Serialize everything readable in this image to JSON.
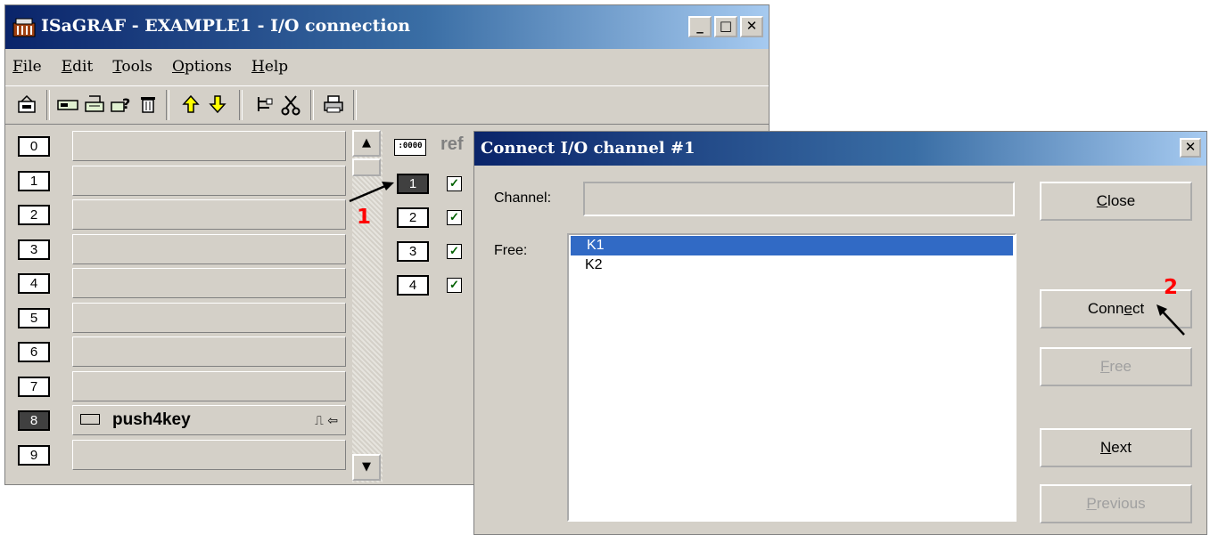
{
  "main_window": {
    "title": "ISaGRAF - EXAMPLE1 - I/O connection",
    "controls": {
      "minimize": "_",
      "maximize": "□",
      "close": "✕"
    },
    "menu": [
      {
        "first": "F",
        "rest": "ile"
      },
      {
        "first": "E",
        "rest": "dit"
      },
      {
        "first": "T",
        "rest": "ools"
      },
      {
        "first": "O",
        "rest": "ptions"
      },
      {
        "first": "H",
        "rest": "elp"
      }
    ],
    "toolbar_icons": [
      "open-icon",
      "board-icon",
      "board-edit-icon",
      "board-help-icon",
      "delete-icon",
      "up-arrow-icon",
      "down-arrow-icon",
      "tree-icon",
      "cut-icon",
      "print-icon"
    ]
  },
  "slots": [
    {
      "num": "0",
      "variable": ""
    },
    {
      "num": "1",
      "variable": ""
    },
    {
      "num": "2",
      "variable": ""
    },
    {
      "num": "3",
      "variable": ""
    },
    {
      "num": "4",
      "variable": ""
    },
    {
      "num": "5",
      "variable": ""
    },
    {
      "num": "6",
      "variable": ""
    },
    {
      "num": "7",
      "variable": ""
    },
    {
      "num": "8",
      "variable": "push4key",
      "symbols": "⎍ ⇦"
    },
    {
      "num": "9",
      "variable": ""
    }
  ],
  "channel_panel": {
    "header_icon": ":0000",
    "header_text": "ref",
    "channels": [
      "1",
      "2",
      "3",
      "4"
    ],
    "check_mark": "✓"
  },
  "annotations": {
    "arrow1_label": "1",
    "arrow2_label": "2"
  },
  "dialog": {
    "title": "Connect I/O channel #1",
    "close_glyph": "✕",
    "channel_label": "Channel:",
    "channel_value": "",
    "free_label": "Free:",
    "free_items": [
      "K1",
      "K2"
    ],
    "selected_item": "K1",
    "buttons": {
      "close": {
        "u": "C",
        "rest": "lose"
      },
      "connect": {
        "pre": "Conn",
        "u": "e",
        "rest": "ct"
      },
      "free": {
        "u": "F",
        "rest": "ree"
      },
      "next": {
        "u": "N",
        "rest": "ext"
      },
      "previous": {
        "u": "P",
        "rest": "revious"
      }
    }
  }
}
